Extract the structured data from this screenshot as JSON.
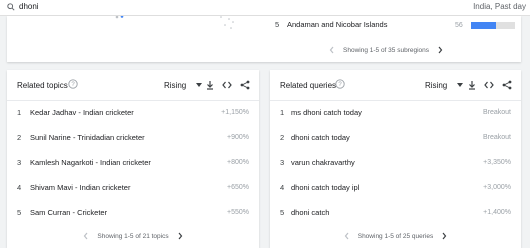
{
  "search": {
    "query": "dhoni",
    "meta": "India, Past day"
  },
  "map_list": {
    "row": {
      "rank": "5",
      "label": "Andaman and Nicobar Islands",
      "value": "56",
      "fill": 0.56
    },
    "pager": "Showing 1-5 of 35 subregions"
  },
  "related_topics": {
    "title": "Related topics",
    "filter": "Rising",
    "items": [
      {
        "rank": "1",
        "label": "Kedar Jadhav - Indian cricketer",
        "value": "+1,150%"
      },
      {
        "rank": "2",
        "label": "Sunil Narine - Trinidadian cricketer",
        "value": "+900%"
      },
      {
        "rank": "3",
        "label": "Kamlesh Nagarkoti - Indian cricketer",
        "value": "+800%"
      },
      {
        "rank": "4",
        "label": "Shivam Mavi - Indian cricketer",
        "value": "+650%"
      },
      {
        "rank": "5",
        "label": "Sam Curran - Cricketer",
        "value": "+550%"
      }
    ],
    "pager": "Showing 1-5 of 21 topics"
  },
  "related_queries": {
    "title": "Related queries",
    "filter": "Rising",
    "items": [
      {
        "rank": "1",
        "label": "ms dhoni catch today",
        "value": "Breakout"
      },
      {
        "rank": "2",
        "label": "dhoni catch today",
        "value": "Breakout"
      },
      {
        "rank": "3",
        "label": "varun chakravarthy",
        "value": "+3,350%"
      },
      {
        "rank": "4",
        "label": "dhoni catch today ipl",
        "value": "+3,000%"
      },
      {
        "rank": "5",
        "label": "dhoni catch",
        "value": "+1,400%"
      }
    ],
    "pager": "Showing 1-5 of 25 queries"
  },
  "colors": {
    "accent": "#4285f4",
    "muted": "#9aa0a6",
    "background": "#f1f3f4"
  },
  "icons": [
    "search-icon",
    "help-icon",
    "dropdown-arrow-icon",
    "download-icon",
    "embed-icon",
    "share-icon",
    "chevron-left-icon",
    "chevron-right-icon"
  ]
}
